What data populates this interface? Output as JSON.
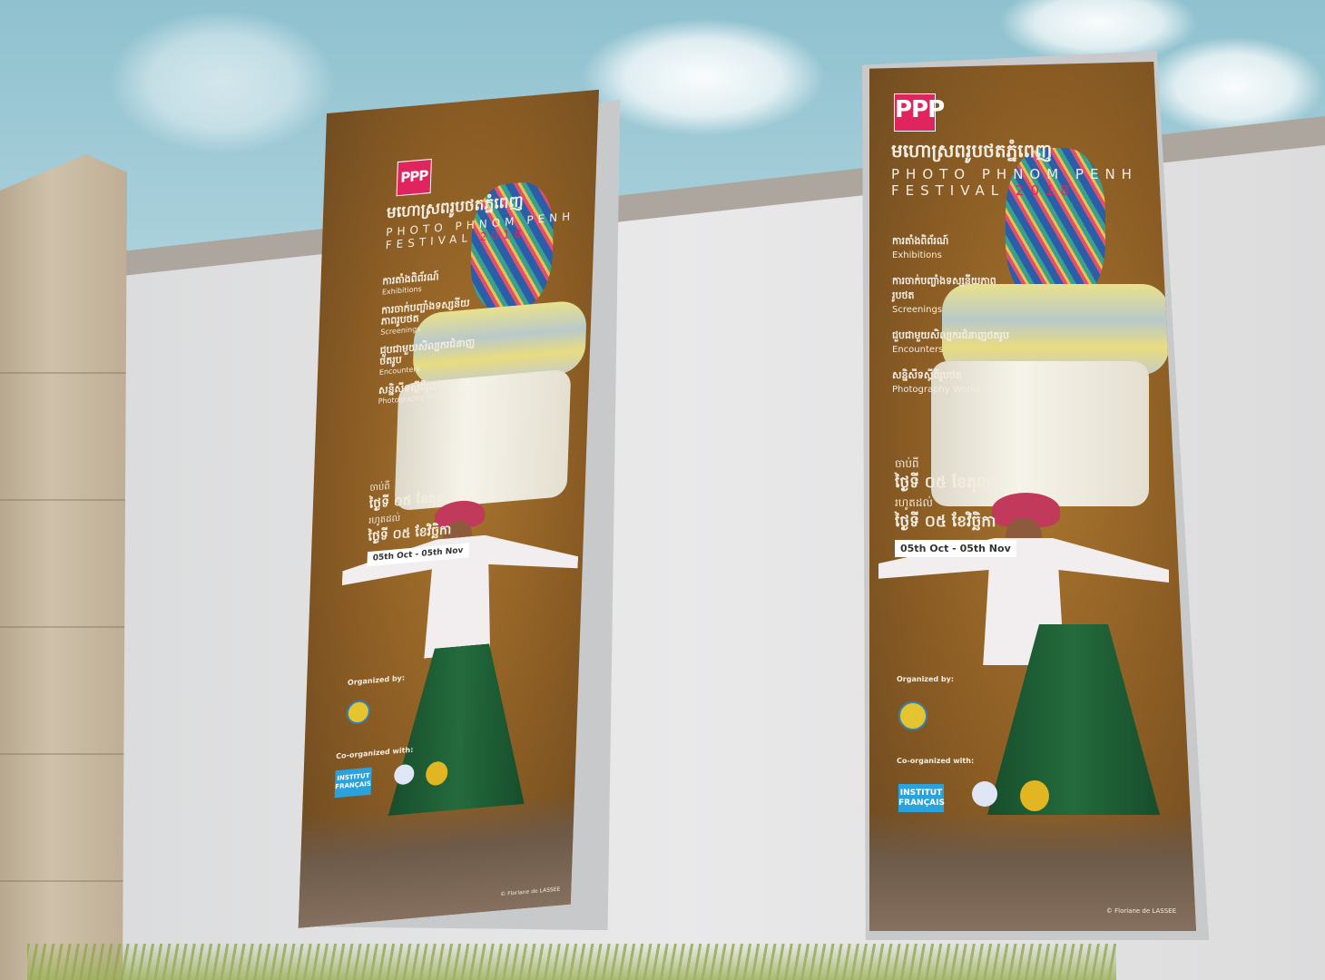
{
  "poster": {
    "logo_text": "PPP",
    "title_kh": "មហោស្រពរូបថតភ្នំពេញ",
    "title_en_1": "PHOTO PHNOM PENH",
    "title_en_2": "FESTIVAL",
    "year": "2018",
    "items": [
      {
        "kh": "ការតាំងពិព័រណ៍",
        "en": "Exhibitions"
      },
      {
        "kh": "ការចាក់បញ្ចាំងទស្សនីយភាពរូបថត",
        "en": "Screenings"
      },
      {
        "kh": "ជួបជាមួយសិល្បករជំនាញថតរូប",
        "en": "Encounters"
      },
      {
        "kh": "សន្និសីទស្តីពីរូបថត",
        "en": "Photography Workshops"
      }
    ],
    "from_kh": "ចាប់ពី",
    "start_kh": "ថ្ងៃទី ០៥ ខែតុលា",
    "to_kh": "រហូតដល់",
    "end_kh": "ថ្ងៃទី ០៥ ខែវិច្ឆិកា",
    "date_en": "05th Oct - 05th Nov",
    "organized_by": "Organized by:",
    "co_organized": "Co-organized with:",
    "institut": "INSTITUT FRANÇAIS",
    "credit": "© Floriane de LASSEE"
  }
}
